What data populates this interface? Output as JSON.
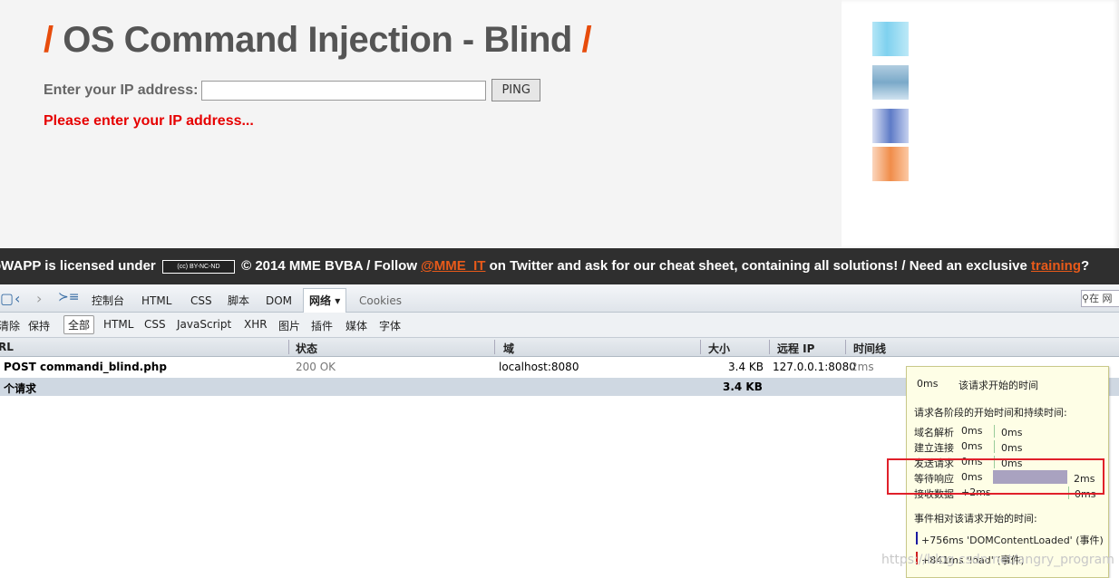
{
  "page": {
    "title": "OS Command Injection - Blind",
    "title_slash": "/",
    "ip_label": "Enter your IP address:",
    "ip_value": "",
    "ping_label": "PING",
    "error_text": "Please enter your IP address..."
  },
  "footer": {
    "prefix": "bWAPP is licensed under",
    "cc_badge": "(cc) BY-NC-ND",
    "mid": "© 2014 MME BVBA / Follow",
    "twitter_link": "@MME_IT",
    "after_twitter": "on Twitter and ask for our cheat sheet, containing all solutions! / Need an exclusive",
    "training_link": "training",
    "end": "?"
  },
  "devtools": {
    "tabs": [
      "控制台",
      "HTML",
      "CSS",
      "脚本",
      "DOM",
      "网络",
      "Cookies"
    ],
    "active_tab_arrow": "▾",
    "search_placeholder": "在 网",
    "filters": [
      "清除",
      "保持",
      "全部",
      "HTML",
      "CSS",
      "JavaScript",
      "XHR",
      "图片",
      "插件",
      "媒体",
      "字体"
    ],
    "columns": {
      "url": "RL",
      "status": "状态",
      "domain": "域",
      "size": "大小",
      "remote_ip": "远程 IP",
      "timeline": "时间线"
    },
    "request": {
      "method_url": "POST commandi_blind.php",
      "status": "200 OK",
      "domain": "localhost:8080",
      "size": "3.4 KB",
      "remote_ip": "127.0.0.1:8080",
      "time": "2ms"
    },
    "summary": {
      "count_label": "个请求",
      "total_size": "3.4 KB"
    },
    "tooltip": {
      "start_time": "0ms",
      "start_label": "该请求开始的时间",
      "phases_heading": "请求各阶段的开始时间和持续时间:",
      "phases": [
        {
          "name": "域名解析",
          "start": "0ms",
          "duration": "0ms"
        },
        {
          "name": "建立连接",
          "start": "0ms",
          "duration": "0ms"
        },
        {
          "name": "发送请求",
          "start": "0ms",
          "duration": "0ms"
        },
        {
          "name": "等待响应",
          "start": "0ms",
          "duration": "2ms"
        },
        {
          "name": "接收数据",
          "start": "+2ms",
          "duration": "0ms"
        }
      ],
      "events_heading": "事件相对该请求开始的时间:",
      "events": [
        {
          "text": "+756ms 'DOMContentLoaded' (事件)",
          "color": "#1a1aa0"
        },
        {
          "text": "+841ms 'load' (事件)",
          "color": "#d02020"
        }
      ]
    },
    "watermark": "https://blog.csdn.net/angry_program"
  },
  "colors": {
    "accent_orange": "#e74c0c",
    "error_red": "#e60000",
    "highlight_box": "#e0202a"
  }
}
